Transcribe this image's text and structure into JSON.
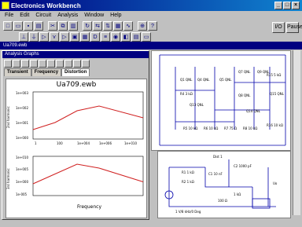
{
  "window": {
    "title": "Electronics Workbench",
    "min": "_",
    "max": "□",
    "close": "×"
  },
  "menu": [
    "File",
    "Edit",
    "Circuit",
    "Analysis",
    "Window",
    "Help"
  ],
  "right_buttons": [
    "I/O",
    "Pause"
  ],
  "document": {
    "title": "Ua709.ewb"
  },
  "panel": {
    "title": "Analysis Graphs",
    "tabs": [
      "Transient",
      "Frequency",
      "Distortion"
    ]
  },
  "plot": {
    "title": "Ua709.ewb",
    "top": {
      "ylabel": "2nd harmonic",
      "yticks": [
        "1e+003",
        "1e+002",
        "1e+001",
        "1e+000"
      ],
      "xticks": [
        "1",
        "100",
        "1e+004",
        "1e+006",
        "1e+010"
      ]
    },
    "bottom": {
      "ylabel": "3rd harmonic",
      "yticks": [
        "1e+010",
        "1e+005",
        "1e+000",
        "1e-005"
      ],
      "xlabel": "Frequency"
    }
  },
  "schematic": {
    "transistors": [
      "Q1 QNL",
      "Q4 QNL",
      "Q5 QNL",
      "Q7 QNL",
      "Q8 QNL",
      "Q9 QNL",
      "Q13 QNL",
      "Q14 QNL",
      "Q15 QNL"
    ],
    "resistors": [
      "R4 3 kΩ",
      "R5 10 kΩ",
      "R6 10 kΩ",
      "R7 75 Ω",
      "R8 10 kΩ",
      "R15 5 kΩ",
      "R16 10 kΩ"
    ],
    "subcircuit": {
      "title": "Dist 1",
      "source": "1 V/8 kHz/0 Deg",
      "parts": [
        "R1 1 kΩ",
        "R2 1 kΩ",
        "C1 10 nF",
        "C2 1000 pF",
        "1 kΩ",
        "100 Ω",
        "Uo"
      ]
    }
  },
  "chart_data": [
    {
      "type": "line",
      "title": "Ua709.ewb",
      "ylabel": "2nd harmonic",
      "x": [
        1,
        100,
        10000,
        1000000,
        10000000000
      ],
      "series": [
        {
          "values": [
            0.2,
            0.35,
            0.6,
            0.7,
            0.45
          ]
        }
      ]
    },
    {
      "type": "line",
      "ylabel": "3rd harmonic",
      "xlabel": "Frequency",
      "x": [
        1,
        100,
        10000,
        1000000,
        10000000000
      ],
      "series": [
        {
          "values": [
            0.3,
            0.55,
            0.8,
            0.7,
            0.35
          ]
        }
      ]
    }
  ]
}
